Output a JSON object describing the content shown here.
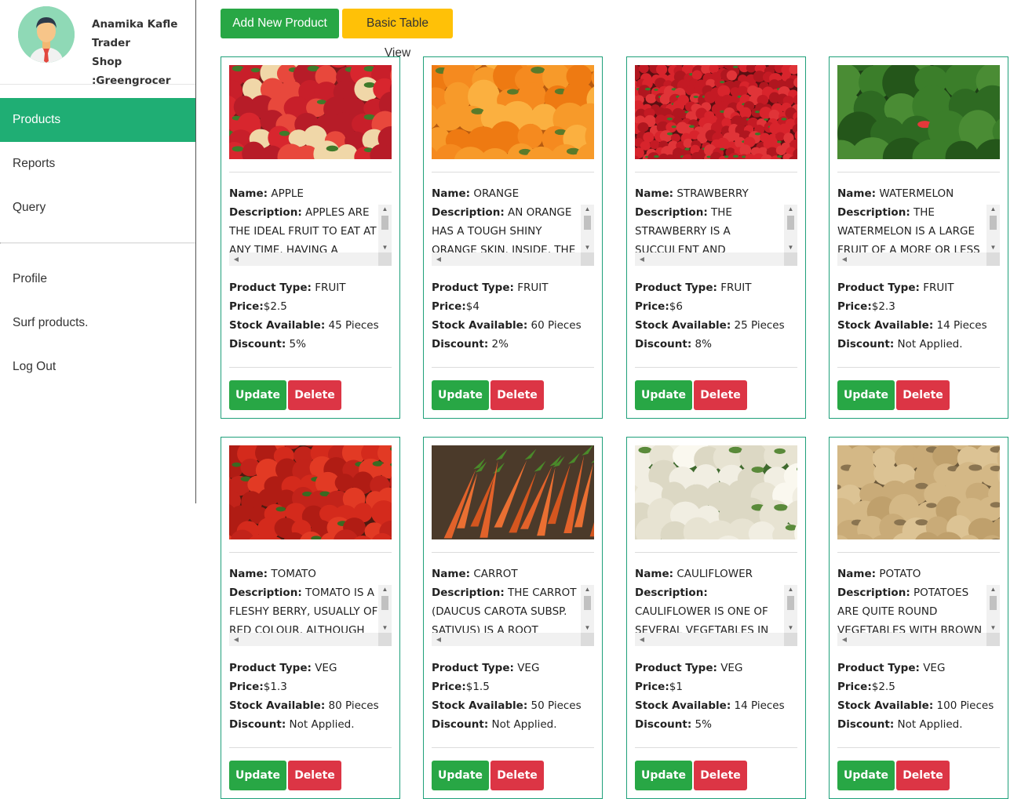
{
  "user": {
    "name": "Anamika Kafle",
    "role": "Trader",
    "shop": "Shop :Greengrocer"
  },
  "sidebar": {
    "items": [
      {
        "label": "Products",
        "active": true
      },
      {
        "label": "Reports"
      },
      {
        "label": "Query"
      }
    ],
    "items2": [
      {
        "label": "Profile"
      },
      {
        "label": "Surf products."
      },
      {
        "label": "Log Out"
      }
    ]
  },
  "toolbar": {
    "add_label": "Add New Product",
    "basic_label": "Basic Table View"
  },
  "labels": {
    "name": "Name:",
    "description": "Description:",
    "type": "Product Type:",
    "price": "Price:",
    "stock": "Stock Available:",
    "discount": "Discount:",
    "update": "Update",
    "delete": "Delete"
  },
  "products": [
    {
      "name": "APPLE",
      "description": "APPLES ARE THE IDEAL FRUIT TO EAT AT ANY TIME, HAVING A POSITIVE",
      "type": "FRUIT",
      "price": "$2.5",
      "stock": "45 Pieces",
      "discount": "5%",
      "image": "apples"
    },
    {
      "name": "ORANGE",
      "description": "AN ORANGE HAS A TOUGH SHINY ORANGE SKIN. INSIDE, THE",
      "type": "FRUIT",
      "price": "$4",
      "stock": "60 Pieces",
      "discount": "2%",
      "image": "oranges"
    },
    {
      "name": "STRAWBERRY",
      "description": "THE STRAWBERRY IS A SUCCULENT AND",
      "type": "FRUIT",
      "price": "$6",
      "stock": "25 Pieces",
      "discount": "8%",
      "image": "strawberries"
    },
    {
      "name": "WATERMELON",
      "description": "THE WATERMELON IS A LARGE FRUIT OF A MORE OR LESS",
      "type": "FRUIT",
      "price": "$2.3",
      "stock": "14 Pieces",
      "discount": "Not Applied.",
      "image": "watermelons"
    },
    {
      "name": "TOMATO",
      "description": "TOMATO IS A FLESHY BERRY, USUALLY OF RED COLOUR, ALTHOUGH",
      "type": "VEG",
      "price": "$1.3",
      "stock": "80 Pieces",
      "discount": "Not Applied.",
      "image": "tomatoes"
    },
    {
      "name": "CARROT",
      "description": "THE CARROT (DAUCUS CAROTA SUBSP. SATIVUS) IS A ROOT",
      "type": "VEG",
      "price": "$1.5",
      "stock": "50 Pieces",
      "discount": "Not Applied.",
      "image": "carrots"
    },
    {
      "name": "CAULIFLOWER",
      "description": "CAULIFLOWER IS ONE OF SEVERAL VEGETABLES IN THE SPECIES",
      "type": "VEG",
      "price": "$1",
      "stock": "14 Pieces",
      "discount": "5%",
      "image": "cauliflowers"
    },
    {
      "name": "POTATO",
      "description": "POTATOES ARE QUITE ROUND VEGETABLES WITH BROWN OR RED",
      "type": "VEG",
      "price": "$2.5",
      "stock": "100 Pieces",
      "discount": "Not Applied.",
      "image": "potatoes"
    }
  ]
}
